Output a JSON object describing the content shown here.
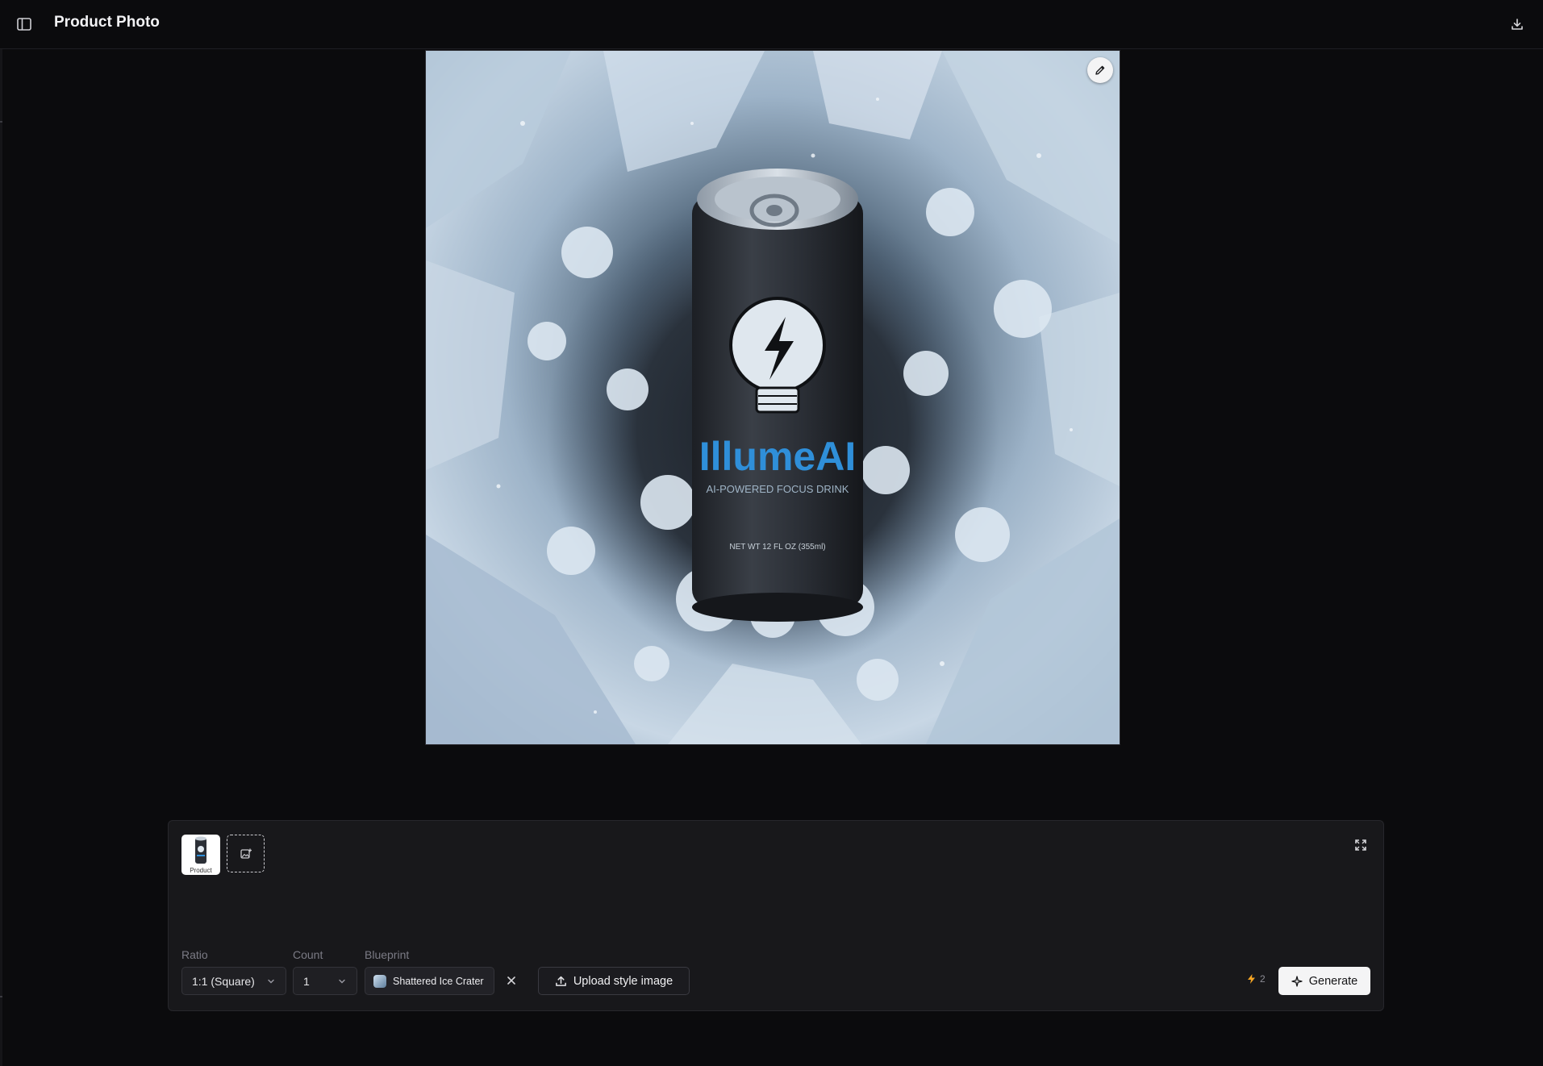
{
  "header": {
    "title": "Product Photo",
    "sidebar_toggle_icon": "sidebar-toggle-icon",
    "download_icon": "download-icon"
  },
  "image": {
    "can_brand": "IllumeAI",
    "can_tagline": "AI-POWERED FOCUS DRINK",
    "can_netwt": "NET WT 12 FL OZ (355ml)",
    "edit_icon": "pencil-icon",
    "colors": {
      "ice": "#c6d6e6",
      "ice_dark": "#6f879f",
      "can": "#2b2f36",
      "brand": "#2f8fd9"
    }
  },
  "panel": {
    "thumbnail_label": "Product",
    "ratio": {
      "label": "Ratio",
      "value": "1:1 (Square)"
    },
    "count": {
      "label": "Count",
      "value": "1"
    },
    "blueprint": {
      "label": "Blueprint",
      "value": "Shattered Ice Crater"
    },
    "upload_style_label": "Upload style image",
    "credits": "2",
    "generate_label": "Generate",
    "accent_bolt": "#f5a524"
  }
}
